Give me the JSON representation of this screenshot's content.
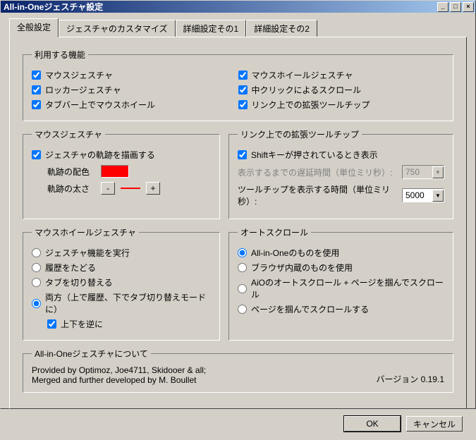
{
  "window": {
    "title": "All-in-Oneジェスチャ設定"
  },
  "tabs": [
    {
      "label": "全般設定",
      "active": true
    },
    {
      "label": "ジェスチャのカスタマイズ",
      "active": false
    },
    {
      "label": "詳細設定その1",
      "active": false
    },
    {
      "label": "詳細設定その2",
      "active": false
    }
  ],
  "features": {
    "legend": "利用する機能",
    "left": [
      {
        "label": "マウスジェスチャ",
        "checked": true
      },
      {
        "label": "ロッカージェスチャ",
        "checked": true
      },
      {
        "label": "タブバー上でマウスホイール",
        "checked": true
      }
    ],
    "right": [
      {
        "label": "マウスホイールジェスチャ",
        "checked": true
      },
      {
        "label": "中クリックによるスクロール",
        "checked": true
      },
      {
        "label": "リンク上での拡張ツールチップ",
        "checked": true
      }
    ]
  },
  "mouseGesture": {
    "legend": "マウスジェスチャ",
    "drawTrail": {
      "label": "ジェスチャの軌跡を描画する",
      "checked": true
    },
    "trailColor": {
      "label": "軌跡の配色",
      "value": "#ff0000"
    },
    "trailWidth": {
      "label": "軌跡の太さ",
      "minus": "-",
      "plus": "+"
    }
  },
  "linkTooltip": {
    "legend": "リンク上での拡張ツールチップ",
    "shiftShow": {
      "label": "Shiftキーが押されているとき表示",
      "checked": true
    },
    "delay": {
      "label": "表示するまでの遅延時間（単位ミリ秒）:",
      "value": "750",
      "disabled": true
    },
    "duration": {
      "label": "ツールチップを表示する時間（単位ミリ秒）:",
      "value": "5000"
    }
  },
  "wheelGesture": {
    "legend": "マウスホイールジェスチャ",
    "options": [
      {
        "label": "ジェスチャ機能を実行",
        "checked": false
      },
      {
        "label": "履歴をたどる",
        "checked": false
      },
      {
        "label": "タブを切り替える",
        "checked": false
      },
      {
        "label": "両方（上で履歴、下でタブ切り替えモードに）",
        "checked": true
      }
    ],
    "reverse": {
      "label": "上下を逆に",
      "checked": true
    }
  },
  "autoscroll": {
    "legend": "オートスクロール",
    "options": [
      {
        "label": "All-in-Oneのものを使用",
        "checked": true
      },
      {
        "label": "ブラウザ内蔵のものを使用",
        "checked": false
      },
      {
        "label": "AiOのオートスクロール + ページを掴んでスクロール",
        "checked": false
      },
      {
        "label": "ページを掴んでスクロールする",
        "checked": false
      }
    ]
  },
  "about": {
    "legend": "All-in-Oneジェスチャについて",
    "line1": "Provided by Optimoz, Joe4711, Skidooer & all;",
    "line2": "Merged and further developed by M. Boullet",
    "version": "バージョン  0.19.1"
  },
  "buttons": {
    "ok": "OK",
    "cancel": "キャンセル"
  }
}
